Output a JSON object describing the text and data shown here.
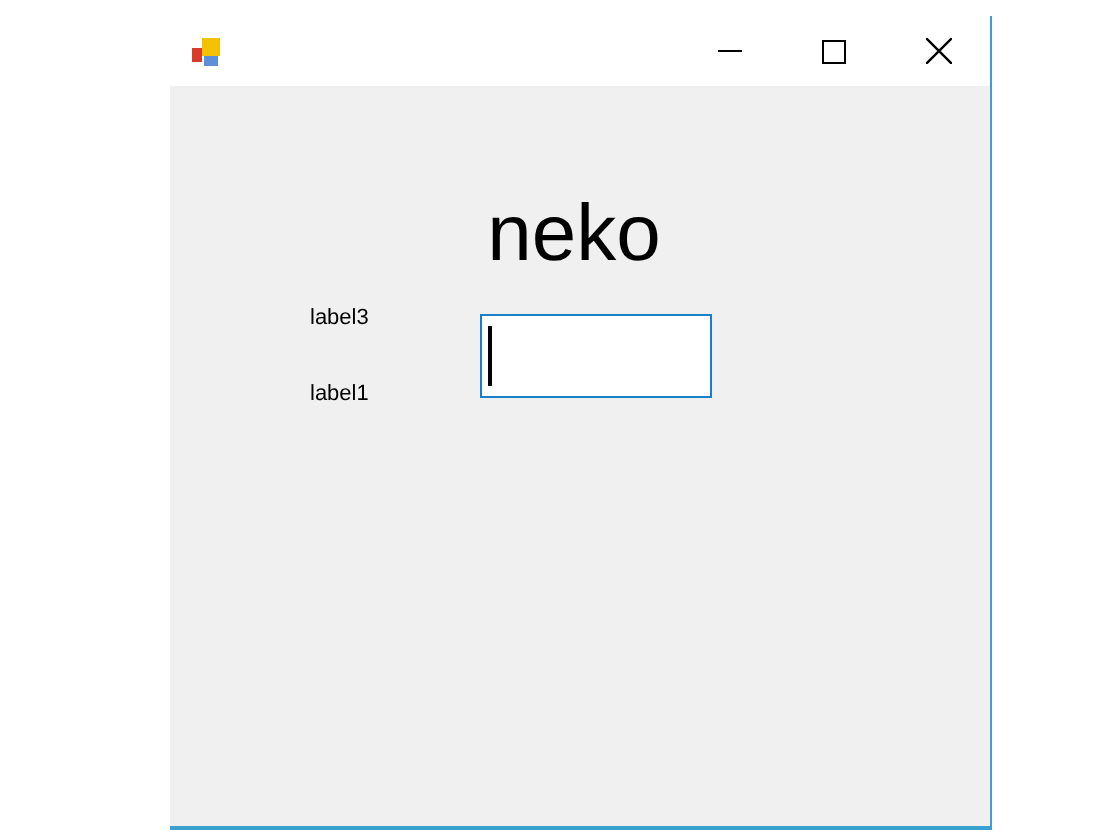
{
  "heading": "neko",
  "labels": [
    "label3",
    "label1"
  ],
  "text_field": {
    "focused": true
  }
}
